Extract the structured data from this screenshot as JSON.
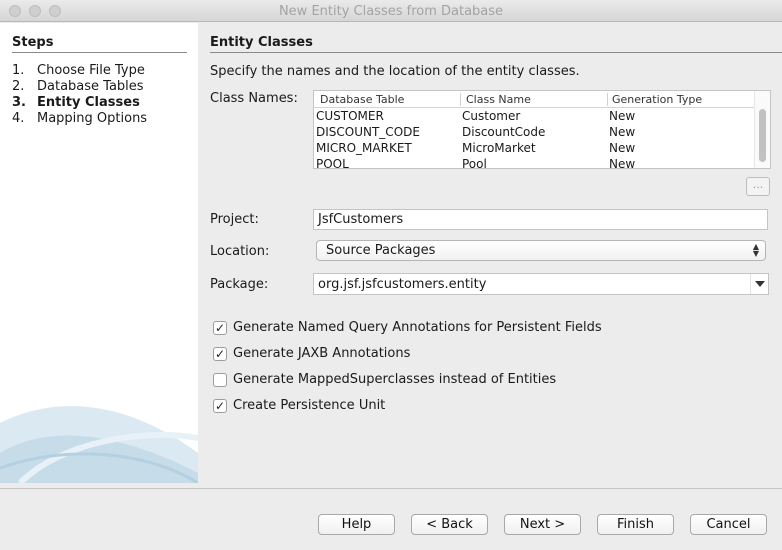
{
  "window": {
    "title": "New Entity Classes from Database"
  },
  "steps": {
    "heading": "Steps",
    "items": [
      {
        "num": "1.",
        "label": "Choose File Type"
      },
      {
        "num": "2.",
        "label": "Database Tables"
      },
      {
        "num": "3.",
        "label": "Entity Classes"
      },
      {
        "num": "4.",
        "label": "Mapping Options"
      }
    ],
    "active_index": 2
  },
  "content": {
    "heading": "Entity Classes",
    "description": "Specify the names and the location of the entity classes."
  },
  "class_names": {
    "label": "Class Names:",
    "columns": [
      "Database Table",
      "Class Name",
      "Generation Type"
    ],
    "rows": [
      [
        "CUSTOMER",
        "Customer",
        "New"
      ],
      [
        "DISCOUNT_CODE",
        "DiscountCode",
        "New"
      ],
      [
        "MICRO_MARKET",
        "MicroMarket",
        "New"
      ],
      [
        "POOL",
        "Pool",
        "New"
      ]
    ],
    "ellipsis_label": "..."
  },
  "project": {
    "label": "Project:",
    "value": "JsfCustomers"
  },
  "location": {
    "label": "Location:",
    "value": "Source Packages"
  },
  "package": {
    "label": "Package:",
    "value": "org.jsf.jsfcustomers.entity"
  },
  "options": [
    {
      "label": "Generate Named Query Annotations for Persistent Fields",
      "checked": true
    },
    {
      "label": "Generate JAXB Annotations",
      "checked": true
    },
    {
      "label": "Generate MappedSuperclasses instead of Entities",
      "checked": false
    },
    {
      "label": "Create Persistence Unit",
      "checked": true
    }
  ],
  "buttons": {
    "help": "Help",
    "back": "< Back",
    "next": "Next >",
    "finish": "Finish",
    "cancel": "Cancel"
  }
}
